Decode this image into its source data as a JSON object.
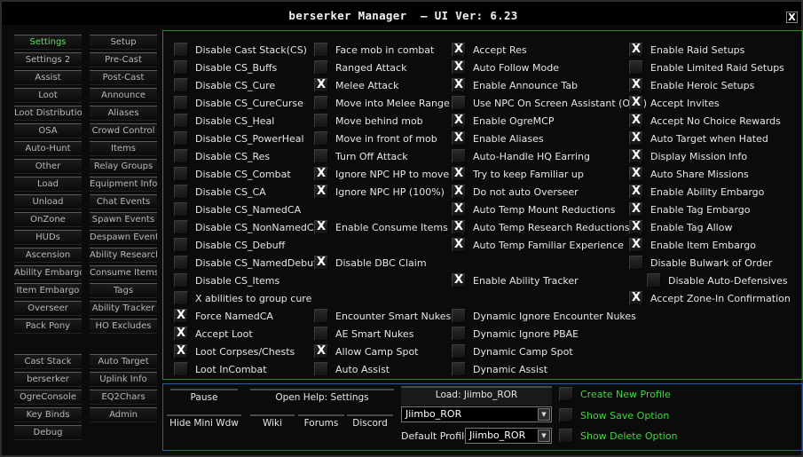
{
  "window": {
    "title": "berserker Manager  — UI Ver: 6.23",
    "close": "X"
  },
  "check_mark": "X",
  "sidebar": {
    "left": [
      "Settings",
      "Settings 2",
      "Assist",
      "Loot",
      "Loot Distribution",
      "OSA",
      "Auto-Hunt",
      "Other",
      "Load",
      "Unload",
      "OnZone",
      "HUDs",
      "Ascension",
      "Ability Embargo",
      "Item Embargo",
      "Overseer",
      "Pack Pony"
    ],
    "right": [
      "Setup",
      "Pre-Cast",
      "Post-Cast",
      "Announce",
      "Aliases",
      "Crowd Control",
      "Items",
      "Relay Groups",
      "Equipment Info",
      "Chat Events",
      "Spawn Events",
      "Despawn Event",
      "Ability Research",
      "Consume Items",
      "Tags",
      "Ability Tracker",
      "HO Excludes"
    ],
    "left2": [
      "Cast Stack",
      "berserker",
      "OgreConsole",
      "Key Binds",
      "Debug"
    ],
    "right2": [
      "Auto Target",
      "Uplink Info",
      "EQ2Chars",
      "Admin"
    ],
    "active": "Settings"
  },
  "options": {
    "col1": [
      {
        "label": "Disable Cast Stack(CS)",
        "checked": false
      },
      {
        "label": "Disable CS_Buffs",
        "checked": false
      },
      {
        "label": "Disable CS_Cure",
        "checked": false
      },
      {
        "label": "Disable CS_CureCurse",
        "checked": false
      },
      {
        "label": "Disable CS_Heal",
        "checked": false
      },
      {
        "label": "Disable CS_PowerHeal",
        "checked": false
      },
      {
        "label": "Disable CS_Res",
        "checked": false
      },
      {
        "label": "Disable CS_Combat",
        "checked": false
      },
      {
        "label": "Disable CS_CA",
        "checked": false
      },
      {
        "label": "Disable CS_NamedCA",
        "checked": false
      },
      {
        "label": "Disable CS_NonNamedCA",
        "checked": false
      },
      {
        "label": "Disable CS_Debuff",
        "checked": false
      },
      {
        "label": "Disable CS_NamedDebuff",
        "checked": false
      },
      {
        "label": "Disable CS_Items",
        "checked": false
      },
      {
        "label": "X abilities to group cure",
        "checked": false
      },
      {
        "label": "Force NamedCA",
        "checked": true
      },
      {
        "label": "Accept Loot",
        "checked": true
      },
      {
        "label": "Loot Corpses/Chests",
        "checked": true
      },
      {
        "label": "Loot InCombat",
        "checked": false
      }
    ],
    "col2": [
      {
        "row": 0,
        "label": "Face mob in combat",
        "checked": false
      },
      {
        "row": 1,
        "label": "Ranged Attack",
        "checked": false
      },
      {
        "row": 2,
        "label": "Melee Attack",
        "checked": true
      },
      {
        "row": 3,
        "label": "Move into Melee Range",
        "checked": false
      },
      {
        "row": 4,
        "label": "Move behind mob",
        "checked": false
      },
      {
        "row": 5,
        "label": "Move in front of mob",
        "checked": false
      },
      {
        "row": 6,
        "label": "Turn Off Attack",
        "checked": false
      },
      {
        "row": 7,
        "label": "Ignore NPC HP to move",
        "checked": true
      },
      {
        "row": 8,
        "label": "Ignore NPC HP (100%)",
        "checked": true
      },
      {
        "row": 10,
        "label": "Enable Consume Items",
        "checked": true
      },
      {
        "row": 12,
        "label": "Disable DBC Claim",
        "checked": true
      },
      {
        "row": 15,
        "label": "Encounter Smart Nukes",
        "checked": false
      },
      {
        "row": 16,
        "label": "AE Smart Nukes",
        "checked": false
      },
      {
        "row": 17,
        "label": "Allow Camp Spot",
        "checked": true
      },
      {
        "row": 18,
        "label": "Auto Assist",
        "checked": false
      }
    ],
    "col3": [
      {
        "row": 0,
        "label": "Accept Res",
        "checked": true
      },
      {
        "row": 1,
        "label": "Auto Follow Mode",
        "checked": true
      },
      {
        "row": 2,
        "label": "Enable Announce Tab",
        "checked": true
      },
      {
        "row": 3,
        "label": "Use NPC On Screen Assistant (OSA)",
        "checked": false
      },
      {
        "row": 4,
        "label": "Enable OgreMCP",
        "checked": true
      },
      {
        "row": 5,
        "label": "Enable Aliases",
        "checked": true
      },
      {
        "row": 6,
        "label": "Auto-Handle HQ Earring",
        "checked": false
      },
      {
        "row": 7,
        "label": "Try to keep Familiar up",
        "checked": true
      },
      {
        "row": 8,
        "label": "Do not auto Overseer",
        "checked": true
      },
      {
        "row": 9,
        "label": "Auto Temp Mount Reductions",
        "checked": true
      },
      {
        "row": 10,
        "label": "Auto Temp Research Reductions",
        "checked": true
      },
      {
        "row": 11,
        "label": "Auto Temp Familiar Experience",
        "checked": true
      },
      {
        "row": 13,
        "label": "Enable Ability Tracker",
        "checked": true
      },
      {
        "row": 15,
        "label": "Dynamic Ignore Encounter Nukes",
        "checked": false
      },
      {
        "row": 16,
        "label": "Dynamic Ignore PBAE",
        "checked": false
      },
      {
        "row": 17,
        "label": "Dynamic Camp Spot",
        "checked": false
      },
      {
        "row": 18,
        "label": "Dynamic Assist",
        "checked": false
      }
    ],
    "col4": [
      {
        "row": 0,
        "label": "Enable Raid Setups",
        "checked": true
      },
      {
        "row": 1,
        "label": "Enable Limited Raid Setups",
        "checked": false
      },
      {
        "row": 2,
        "label": "Enable Heroic Setups",
        "checked": true
      },
      {
        "row": 3,
        "label": "Accept Invites",
        "checked": true
      },
      {
        "row": 4,
        "label": "Accept No Choice Rewards",
        "checked": true
      },
      {
        "row": 5,
        "label": "Auto Target when Hated",
        "checked": true
      },
      {
        "row": 6,
        "label": "Display Mission Info",
        "checked": true
      },
      {
        "row": 7,
        "label": "Auto Share Missions",
        "checked": true
      },
      {
        "row": 8,
        "label": "Enable Ability Embargo",
        "checked": true
      },
      {
        "row": 9,
        "label": "Enable Tag Embargo",
        "checked": true
      },
      {
        "row": 10,
        "label": "Enable Tag Allow",
        "checked": true
      },
      {
        "row": 11,
        "label": "Enable Item Embargo",
        "checked": true
      },
      {
        "row": 12,
        "label": "Disable Bulwark of Order",
        "checked": false
      },
      {
        "row": 13,
        "label": "Disable Auto-Defensives",
        "checked": false,
        "indent": true
      },
      {
        "row": 14,
        "label": "Accept Zone-In Confirmation",
        "checked": true
      }
    ]
  },
  "bottom": {
    "pause": "Pause",
    "open_help": "Open Help: Settings",
    "hide_mini": "Hide Mini Wdw",
    "wiki": "Wiki",
    "forums": "Forums",
    "discord": "Discord",
    "load_label": "Load: Jiimbo_ROR",
    "profile_value": "Jiimbo_ROR",
    "default_profile_label": "Default Profile:",
    "default_profile_value": "Jiimbo_ROR",
    "create_new_profile": "Create New Profile",
    "show_save_option": "Show Save Option",
    "show_delete_option": "Show Delete Option"
  },
  "colors": {
    "main_border": "#2a8a2a",
    "bottom_border": "#2a5aa8",
    "active_tab": "#5fe05f",
    "green_text": "#3ed83e"
  }
}
